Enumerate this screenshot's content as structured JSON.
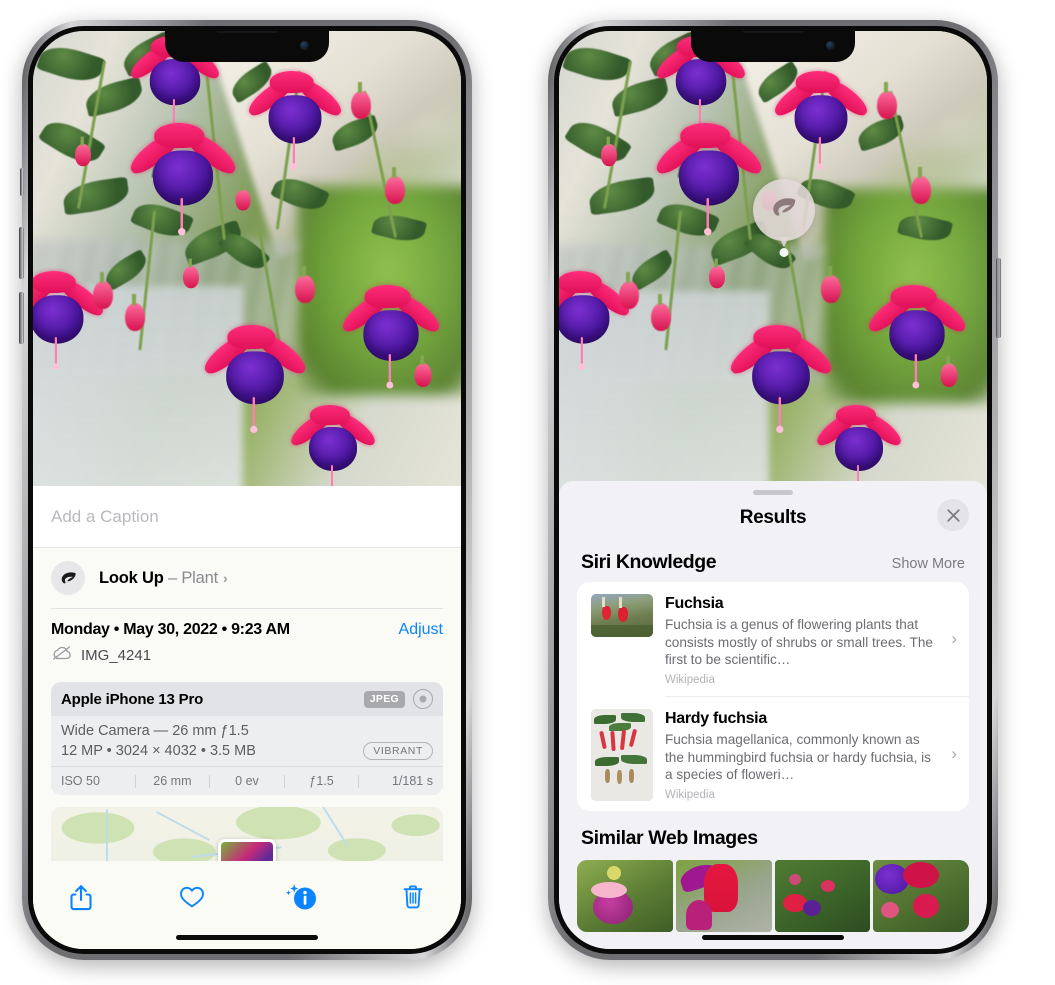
{
  "left_phone": {
    "caption": {
      "placeholder": "Add a Caption",
      "value": ""
    },
    "lookup": {
      "label": "Look Up",
      "dash": " – ",
      "subject": "Plant",
      "chevron": "›",
      "icon": "leaf-icon"
    },
    "meta": {
      "date": "Monday • May 30, 2022 • 9:23 AM",
      "adjust": "Adjust",
      "filename": "IMG_4241",
      "cloud_icon": "icloud-slash-icon"
    },
    "camera": {
      "device": "Apple iPhone 13 Pro",
      "format_badge": "JPEG",
      "aperture_icon": "aperture-icon",
      "lens_line": "Wide Camera — 26 mm ƒ1.5",
      "spec_line": "12 MP • 3024 × 4032 • 3.5 MB",
      "style_badge": "VIBRANT",
      "exif": [
        "ISO 50",
        "26 mm",
        "0 ev",
        "ƒ1.5",
        "1/181 s"
      ]
    },
    "toolbar": [
      {
        "name": "share-button",
        "icon": "share-icon"
      },
      {
        "name": "favorite-button",
        "icon": "heart-icon"
      },
      {
        "name": "info-button",
        "icon": "info-sparkle-icon"
      },
      {
        "name": "delete-button",
        "icon": "trash-icon"
      }
    ]
  },
  "right_phone": {
    "bubble": {
      "icon": "leaf-icon"
    },
    "results": {
      "title": "Results",
      "close_icon": "close-icon",
      "siri_knowledge": {
        "heading": "Siri Knowledge",
        "show_more": "Show More",
        "items": [
          {
            "title": "Fuchsia",
            "description": "Fuchsia is a genus of flowering plants that consists mostly of shrubs or small trees. The first to be scientific…",
            "source": "Wikipedia",
            "chevron": "›"
          },
          {
            "title": "Hardy fuchsia",
            "description": "Fuchsia magellanica, commonly known as the hummingbird fuchsia or hardy fuchsia, is a species of floweri…",
            "source": "Wikipedia",
            "chevron": "›"
          }
        ]
      },
      "similar_web_images": {
        "heading": "Similar Web Images",
        "count": 4
      }
    }
  },
  "colors": {
    "accent_blue": "#0a84ff",
    "sheet_bg": "#fafaf7",
    "results_bg": "#f2f1f6",
    "card_bg": "#ffffff",
    "secondary_text": "#6c6c72",
    "tertiary_text": "#b2b2b8"
  }
}
